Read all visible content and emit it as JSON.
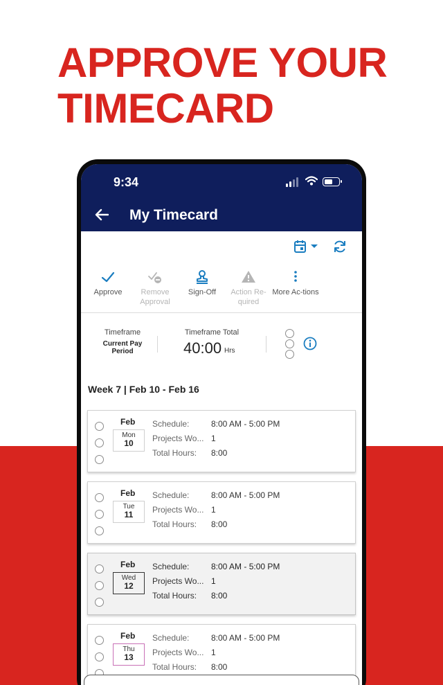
{
  "promo": {
    "headline_line1": "APPROVE YOUR",
    "headline_line2": "TIMECARD",
    "accent_color": "#d8251f"
  },
  "status_bar": {
    "time": "9:34"
  },
  "app_bar": {
    "title": "My Timecard",
    "color": "#0f1e5c"
  },
  "toolbar": {
    "calendar_icon": "calendar-icon",
    "refresh_icon": "refresh-icon"
  },
  "actions": [
    {
      "label": "Approve",
      "icon": "checkmark-icon",
      "enabled": true
    },
    {
      "label": "Remove Approval",
      "icon": "remove-approval-icon",
      "enabled": false
    },
    {
      "label": "Sign-Off",
      "icon": "stamp-icon",
      "enabled": true
    },
    {
      "label": "Action Re-quired",
      "icon": "warning-icon",
      "enabled": false
    },
    {
      "label": "More Ac-tions",
      "icon": "more-vertical-icon",
      "enabled": true
    }
  ],
  "summary": {
    "timeframe_label": "Timeframe",
    "timeframe_value": "Current Pay Period",
    "total_label": "Timeframe Total",
    "total_value": "40:00",
    "total_unit": "Hrs"
  },
  "week": {
    "title": "Week 7 | Feb 10 - Feb 16"
  },
  "labels": {
    "schedule": "Schedule:",
    "projects": "Projects Wo...",
    "total_hours": "Total Hours:"
  },
  "days": [
    {
      "month": "Feb",
      "dow": "Mon",
      "day": "10",
      "schedule": "8:00 AM - 5:00 PM",
      "projects": "1",
      "total": "8:00"
    },
    {
      "month": "Feb",
      "dow": "Tue",
      "day": "11",
      "schedule": "8:00 AM - 5:00 PM",
      "projects": "1",
      "total": "8:00"
    },
    {
      "month": "Feb",
      "dow": "Wed",
      "day": "12",
      "schedule": "8:00 AM - 5:00 PM",
      "projects": "1",
      "total": "8:00"
    },
    {
      "month": "Feb",
      "dow": "Thu",
      "day": "13",
      "schedule": "8:00 AM - 5:00 PM",
      "projects": "1",
      "total": "8:00"
    }
  ]
}
